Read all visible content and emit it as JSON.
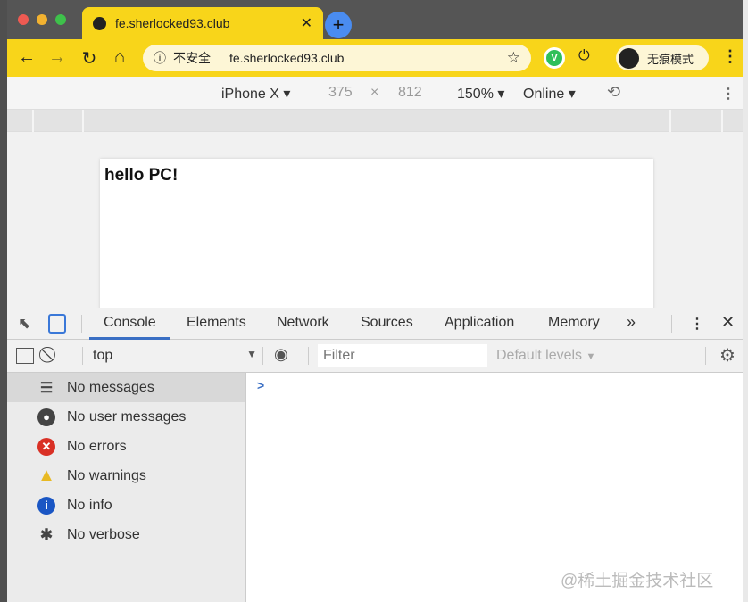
{
  "browser": {
    "tab_title": "fe.sherlocked93.club",
    "security_label": "不安全",
    "url": "fe.sherlocked93.club",
    "incognito_label": "无痕模式",
    "accent_color": "#f8d51a"
  },
  "device_toolbar": {
    "device": "iPhone X",
    "width": "375",
    "times": "×",
    "height": "812",
    "zoom": "150%",
    "network": "Online"
  },
  "page": {
    "text": "hello PC!"
  },
  "devtools": {
    "tabs": [
      "Console",
      "Elements",
      "Network",
      "Sources",
      "Application",
      "Memory"
    ],
    "more": "»",
    "context": "top",
    "filter_placeholder": "Filter",
    "levels": "Default levels",
    "sidebar": [
      {
        "label": "No messages",
        "icon": "list-icon"
      },
      {
        "label": "No user messages",
        "icon": "user-icon"
      },
      {
        "label": "No errors",
        "icon": "error-icon",
        "color": "#d93025"
      },
      {
        "label": "No warnings",
        "icon": "warning-icon",
        "color": "#f2c94c"
      },
      {
        "label": "No info",
        "icon": "info-icon",
        "color": "#1a56c4"
      },
      {
        "label": "No verbose",
        "icon": "bug-icon"
      }
    ],
    "prompt": ">"
  },
  "watermark": "@稀土掘金技术社区"
}
